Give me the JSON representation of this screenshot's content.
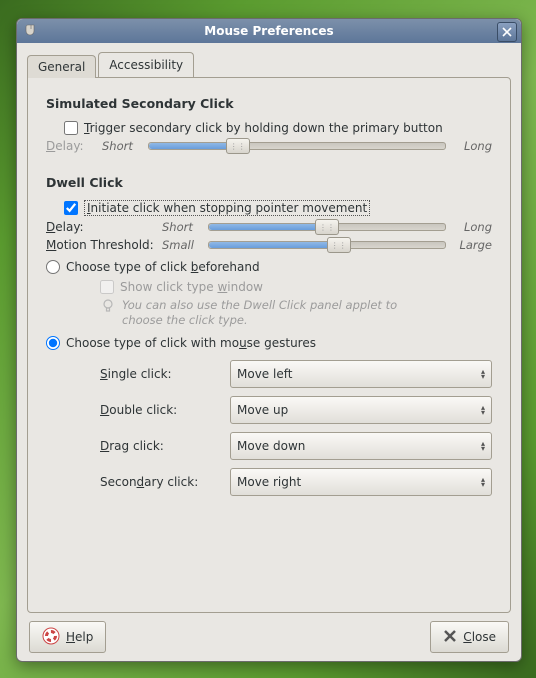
{
  "window": {
    "title": "Mouse Preferences"
  },
  "tabs": [
    {
      "label": "General",
      "active": false
    },
    {
      "label": "Accessibility",
      "active": true
    }
  ],
  "ssc": {
    "heading": "Simulated Secondary Click",
    "trigger_prefix": "T",
    "trigger_text": "rigger secondary click by holding down the primary button",
    "delay_prefix": "D",
    "delay_label": "elay:",
    "short": "Short",
    "long": "Long",
    "slider_pct": 30
  },
  "dwell": {
    "heading": "Dwell Click",
    "initiate_prefix": "I",
    "initiate_text": "nitiate click when stopping pointer movement",
    "delay_prefix": "D",
    "delay_label": "elay:",
    "delay_short": "Short",
    "delay_long": "Long",
    "delay_pct": 50,
    "motion_prefix": "M",
    "motion_label": "otion Threshold:",
    "motion_small": "Small",
    "motion_large": "Large",
    "motion_pct": 55,
    "rb_before_pre": "Choose type of click ",
    "rb_before_b": "b",
    "rb_before_post": "eforehand",
    "show_pre": "Show click type ",
    "show_w": "w",
    "show_post": "indow",
    "tip": "You can also use the Dwell Click panel applet to choose the click type.",
    "rb_gesture_pre": "Choose type of click with mo",
    "rb_gesture_u": "u",
    "rb_gesture_post": "se gestures",
    "gestures": {
      "single_s": "S",
      "single_label": "ingle click:",
      "single_value": "Move left",
      "double_d": "D",
      "double_label": "ouble click:",
      "double_value": "Move up",
      "drag_d": "D",
      "drag_label": "rag click:",
      "drag_value": "Move down",
      "sec_pre": "Secon",
      "sec_d": "d",
      "sec_post": "ary click:",
      "sec_value": "Move right"
    }
  },
  "buttons": {
    "help_h": "H",
    "help_label": "elp",
    "close_c": "C",
    "close_label": "lose"
  }
}
